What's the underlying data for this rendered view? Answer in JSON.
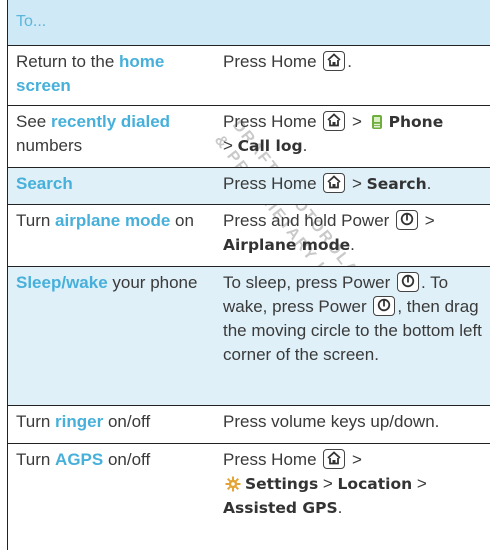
{
  "header": {
    "title": "To..."
  },
  "watermark": {
    "lines": [
      "DRAFT - MOTOROLA CONFIDENTIAL",
      "& PROPRIETARY INFORMATION"
    ],
    "color": "#c8c8c8"
  },
  "keys": {
    "home": "home-key-icon",
    "power": "power-key-icon",
    "phone": "phone-app-icon",
    "settings": "settings-gear-icon"
  },
  "colors": {
    "keyword": "#47b0da",
    "header_bg": "#cfeaf6",
    "highlight_bg": "#dff0f8"
  },
  "rows": {
    "home": {
      "c1_pre": "Return to the ",
      "c1_kw": "home screen",
      "c2_pre": "Press Home ",
      "c2_post": "."
    },
    "dialed": {
      "c1_pre": "See ",
      "c1_kw": "recently dialed",
      "c1_post": " numbers",
      "c2_pre": "Press Home ",
      "c2_mid": " > ",
      "c2_b1": "Phone",
      "c2_gt": "> ",
      "c2_b2": "Call log",
      "c2_post": "."
    },
    "search": {
      "c1_kw": "Search",
      "c2_pre": "Press Home ",
      "c2_mid": " > ",
      "c2_b1": "Search",
      "c2_post": "."
    },
    "airplane": {
      "c1_pre": "Turn ",
      "c1_kw": "airplane mode",
      "c1_post": " on",
      "c2_pre": "Press and hold Power ",
      "c2_mid": " >",
      "c2_b1": "Airplane mode",
      "c2_post": "."
    },
    "sleep": {
      "c1_kw": "Sleep/wake",
      "c1_post": " your phone",
      "c2_a": "To sleep, press Power ",
      "c2_b": ". To wake, press Power ",
      "c2_c": ", then drag the moving circle to the bottom left corner of the screen."
    },
    "ringer": {
      "c1_pre": "Turn ",
      "c1_kw": "ringer",
      "c1_post": " on/off",
      "c2": "Press volume keys up/down."
    },
    "agps": {
      "c1_pre": "Turn ",
      "c1_kw": "AGPS",
      "c1_post": " on/off",
      "c2_pre": "Press Home ",
      "c2_mid": " >",
      "c2_b1": "Settings",
      "c2_gt1": " > ",
      "c2_b2": "Location",
      "c2_gt2": " >",
      "c2_b3": "Assisted GPS",
      "c2_post": "."
    }
  }
}
